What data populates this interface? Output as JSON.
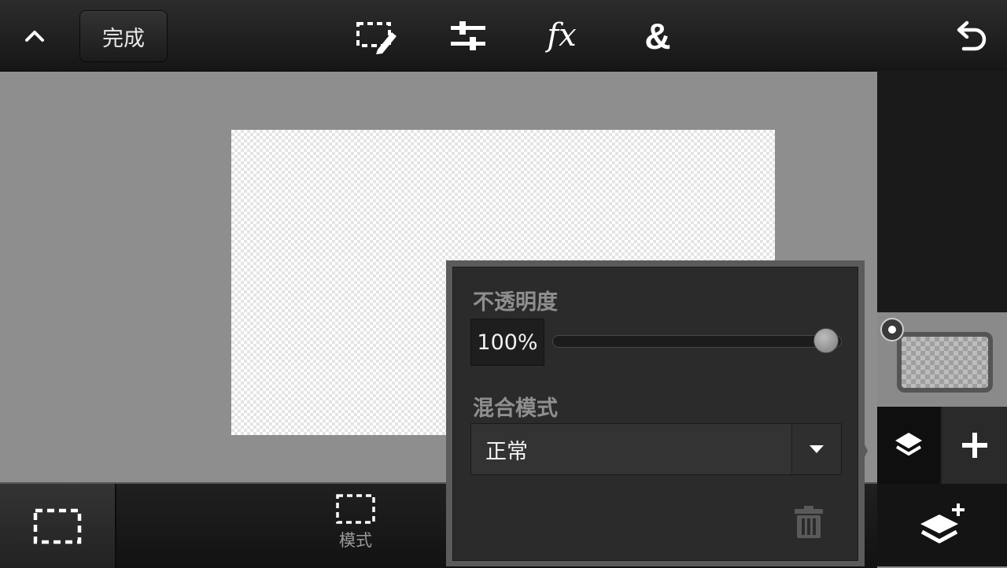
{
  "toolbar": {
    "collapse_icon": "chevron-up-icon",
    "done_label": "完成",
    "tools": [
      {
        "name": "selection-edit",
        "icon": "dashed-rect-pencil-icon"
      },
      {
        "name": "adjustments",
        "icon": "sliders-icon"
      },
      {
        "name": "effects",
        "icon": "fx-icon",
        "label": "fx"
      },
      {
        "name": "blend",
        "icon": "ampersand-icon",
        "label": "&"
      }
    ],
    "undo_icon": "undo-icon"
  },
  "layer_settings": {
    "opacity_label": "不透明度",
    "opacity_value": "100%",
    "opacity_level": 1.0,
    "blend_mode_label": "混合模式",
    "blend_mode_value": "正常",
    "delete_icon": "trash-icon"
  },
  "layers_panel": {
    "selected_indicator_icon": "radio-selected-icon",
    "layers_icon": "layers-icon",
    "add_icon": "plus-icon",
    "add_layer_icon": "layers-add-icon"
  },
  "bottom_toolbar": {
    "selection_icon": "dashed-rect-icon",
    "mode_label": "模式",
    "mode_icon": "dashed-rect-icon"
  },
  "colors": {
    "toolbar_bg": "#1c1c1c",
    "workspace_bg": "#8e8e8e",
    "panel_bg": "#2b2b2b",
    "label_gray": "#8f8f8f"
  }
}
